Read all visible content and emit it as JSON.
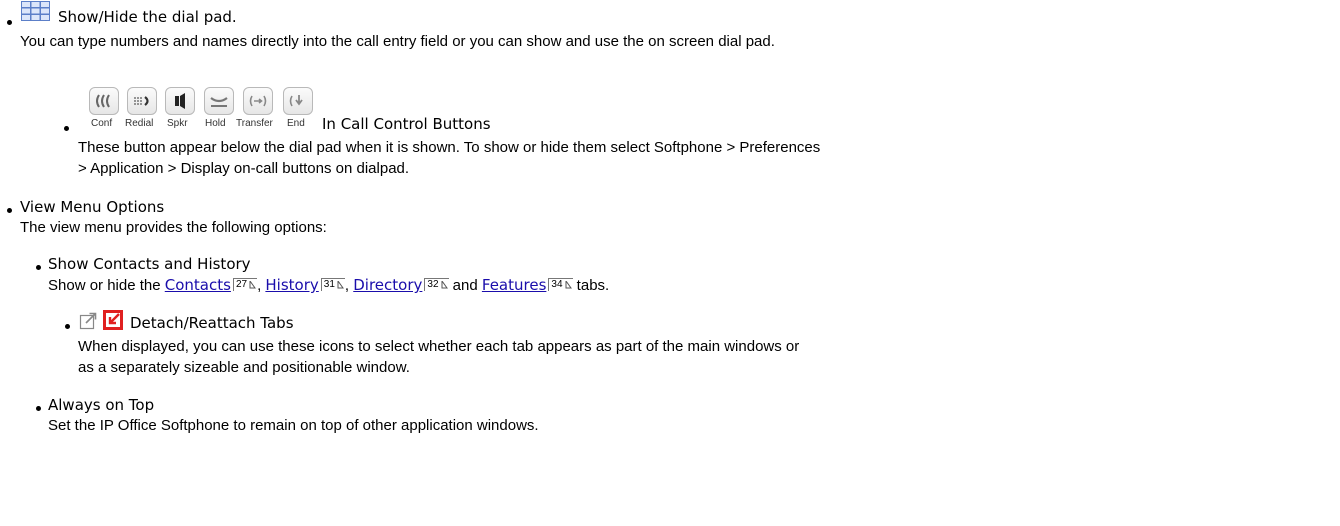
{
  "dialpad_item": {
    "icon": "dialpad-grid-icon",
    "title": "Show/Hide the dial pad.",
    "text": "You can type numbers and names directly into the call entry field or you can show and use the on screen dial pad."
  },
  "call_controls": {
    "buttons": [
      {
        "label": "Conf",
        "icon": "conference-icon"
      },
      {
        "label": "Redial",
        "icon": "redial-icon"
      },
      {
        "label": "Spkr",
        "icon": "speaker-icon"
      },
      {
        "label": "Hold",
        "icon": "hold-icon"
      },
      {
        "label": "Transfer",
        "icon": "transfer-icon"
      },
      {
        "label": "End",
        "icon": "end-call-icon"
      }
    ],
    "title": "In Call Control Buttons",
    "text_line1": "These button appear below the dial pad when it is shown. To show or hide them select Softphone > Preferences",
    "text_line2": "> Application > Display on-call buttons on dialpad."
  },
  "view_menu": {
    "title": "View Menu Options",
    "text": "The view menu provides the following options:"
  },
  "show_contacts": {
    "title": "Show Contacts and History",
    "prefix": "Show or hide the ",
    "links": [
      {
        "label": "Contacts",
        "page": "27"
      },
      {
        "label": "History",
        "page": "31"
      },
      {
        "label": "Directory",
        "page": "32"
      },
      {
        "label": "Features",
        "page": "34"
      }
    ],
    "sep1": ", ",
    "sep2": ", ",
    "sep3": " and ",
    "suffix": " tabs."
  },
  "detach": {
    "icons": [
      "detach-icon",
      "reattach-icon"
    ],
    "title": "Detach/Reattach Tabs",
    "text_line1": "When displayed, you can use these icons to select whether each tab appears as part of the main windows or",
    "text_line2": "as a separately sizeable and positionable window."
  },
  "always_on_top": {
    "title": "Always on Top",
    "text": "Set the IP Office Softphone to remain on top of other application windows."
  },
  "colors": {
    "link": "#1a0dab",
    "dialpad_icon": "#3a62b8",
    "reattach_icon": "#e02020"
  }
}
